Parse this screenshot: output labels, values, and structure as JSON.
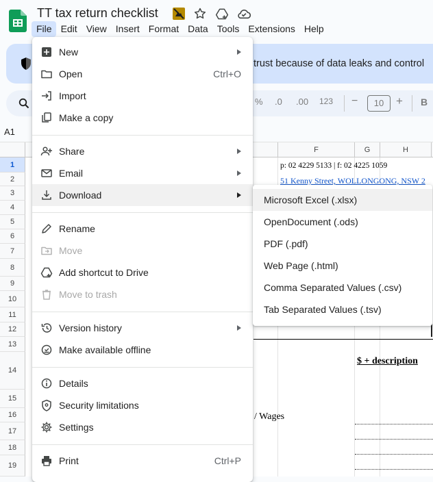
{
  "doc": {
    "title": "TT tax return checklist"
  },
  "menubar": [
    "File",
    "Edit",
    "View",
    "Insert",
    "Format",
    "Data",
    "Tools",
    "Extensions",
    "Help"
  ],
  "banner": {
    "text": "trust because of data leaks and control"
  },
  "toolbar": {
    "percent": "%",
    "dec_decrease": ".0",
    "dec_increase": ".00",
    "number_format": "123",
    "minus": "−",
    "zoom": "10",
    "plus": "+",
    "bold": "B"
  },
  "namebox": "A1",
  "columns": [
    "F",
    "G",
    "H"
  ],
  "rows": [
    "1",
    "2",
    "3",
    "4",
    "5",
    "6",
    "7",
    "8",
    "9",
    "10",
    "11",
    "12",
    "13",
    "14",
    "15",
    "16",
    "17",
    "18",
    "19"
  ],
  "cells": {
    "f1": "p: 02 4229 5133 | f: 02 4225 1059",
    "f2": "51 Kenny Street, WOLLONGONG, NSW 2",
    "r14": "$ + description",
    "r16": "/ Wages"
  },
  "file_menu": [
    {
      "label": "New",
      "icon": "new-sheet-icon",
      "arrow": true
    },
    {
      "label": "Open",
      "icon": "folder-icon",
      "shortcut": "Ctrl+O"
    },
    {
      "label": "Import",
      "icon": "import-icon"
    },
    {
      "label": "Make a copy",
      "icon": "copy-icon"
    },
    {
      "label": "Share",
      "icon": "share-person-icon",
      "arrow": true
    },
    {
      "label": "Email",
      "icon": "email-icon",
      "arrow": true
    },
    {
      "label": "Download",
      "icon": "download-icon",
      "arrow": true
    },
    {
      "label": "Rename",
      "icon": "pencil-icon"
    },
    {
      "label": "Move",
      "icon": "move-folder-icon",
      "disabled": true
    },
    {
      "label": "Add shortcut to Drive",
      "icon": "drive-shortcut-icon"
    },
    {
      "label": "Move to trash",
      "icon": "trash-icon",
      "disabled": true
    },
    {
      "label": "Version history",
      "icon": "history-icon",
      "arrow": true
    },
    {
      "label": "Make available offline",
      "icon": "offline-check-icon"
    },
    {
      "label": "Details",
      "icon": "info-icon"
    },
    {
      "label": "Security limitations",
      "icon": "security-shield-icon"
    },
    {
      "label": "Settings",
      "icon": "gear-icon"
    },
    {
      "label": "Print",
      "icon": "printer-icon",
      "shortcut": "Ctrl+P"
    }
  ],
  "download_menu": [
    "Microsoft Excel (.xlsx)",
    "OpenDocument (.ods)",
    "PDF (.pdf)",
    "Web Page (.html)",
    "Comma Separated Values (.csv)",
    "Tab Separated Values (.tsv)"
  ],
  "colors": {
    "accent": "#0b57d0",
    "banner": "#d3e3fd",
    "sheets_green": "#0f9d58",
    "link": "#1155cc"
  }
}
